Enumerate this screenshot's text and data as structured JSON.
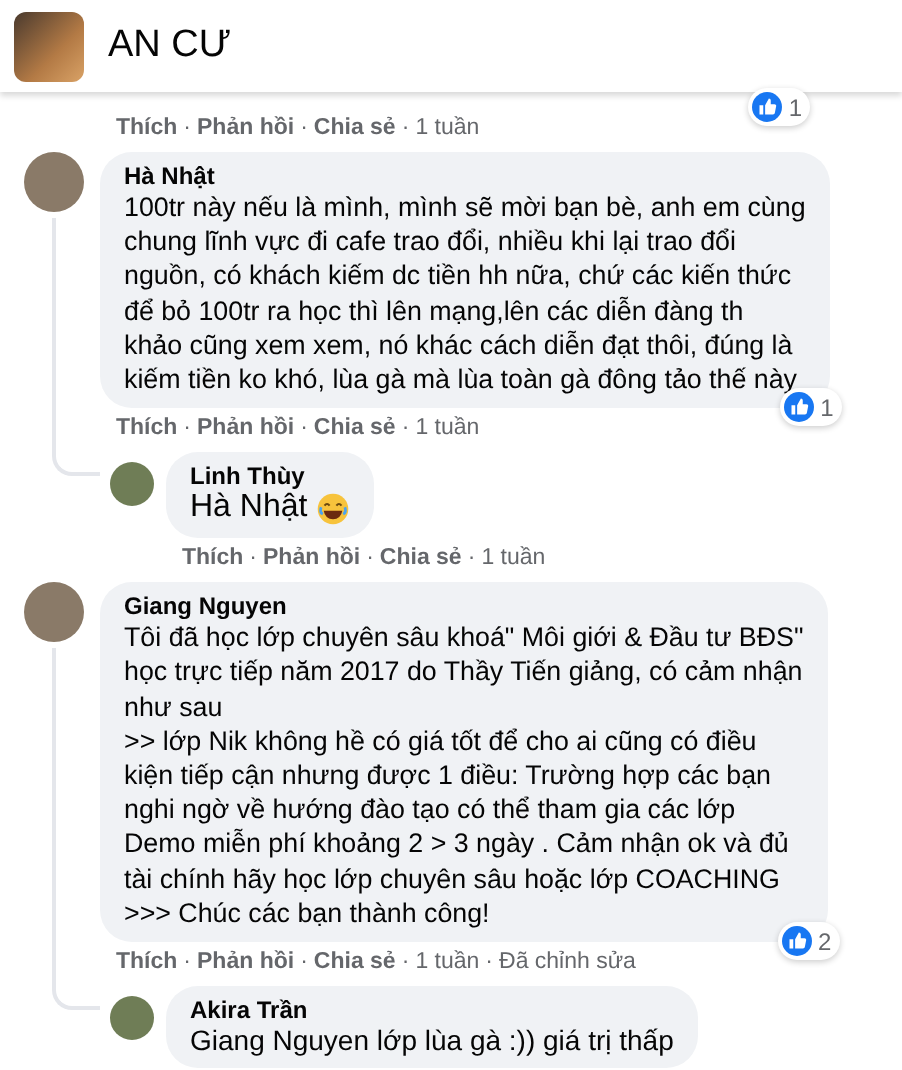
{
  "page": {
    "name": "AN CƯ"
  },
  "separator": "·",
  "previous_comment": {
    "actions": [
      "Thích",
      "Phản hồi",
      "Chia sẻ"
    ],
    "time": "1 tuần",
    "reactions": "1"
  },
  "comments": [
    {
      "author": "Hà Nhật",
      "text": "100tr này nếu là mình, mình sẽ mời bạn bè, anh em cùng\nchung lĩnh vực đi cafe trao đổi, nhiều khi lại trao đổi\nnguồn, có khách kiếm dc tiền hh nữa, chứ các kiến thức\nđể bỏ 100tr ra học thì lên mạng,lên các diễn đàng th\nkhảo cũng xem xem, nó khác cách diễn đạt thôi, đúng là\nkiếm tiền ko khó, lùa gà mà lùa toàn gà đông tảo thế này",
      "actions": [
        "Thích",
        "Phản hồi",
        "Chia sẻ"
      ],
      "time": "1 tuần",
      "reactions": "1",
      "replies": [
        {
          "author": "Linh Thùy",
          "mention": "Hà Nhật",
          "emoji": true,
          "actions": [
            "Thích",
            "Phản hồi",
            "Chia sẻ"
          ],
          "time": "1 tuần"
        }
      ]
    },
    {
      "author": "Giang Nguyen",
      "text": "Tôi đã học lớp chuyên sâu khoá\" Môi giới & Đầu tư BĐS\"\nhọc trực tiếp năm 2017 do Thầy Tiến giảng, có cảm nhận\nnhư sau\n>> lớp Nik không hề có giá tốt để cho ai cũng có điều\nkiện tiếp cận nhưng được 1 điều: Trường hợp các bạn\nnghi ngờ về hướng đào tạo có thể tham gia các lớp\nDemo miễn phí khoảng 2 > 3 ngày . Cảm nhận ok và đủ\ntài chính hãy học lớp chuyên sâu hoặc lớp COACHING\n>>> Chúc các bạn thành công!",
      "actions": [
        "Thích",
        "Phản hồi",
        "Chia sẻ"
      ],
      "time": "1 tuần",
      "edited": "Đã chỉnh sửa",
      "reactions": "2",
      "replies": [
        {
          "author": "Akira Trần",
          "mention": "Giang Nguyen",
          "text": " lớp lùa gà :)) giá trị thấp",
          "emoji": false
        }
      ]
    }
  ]
}
